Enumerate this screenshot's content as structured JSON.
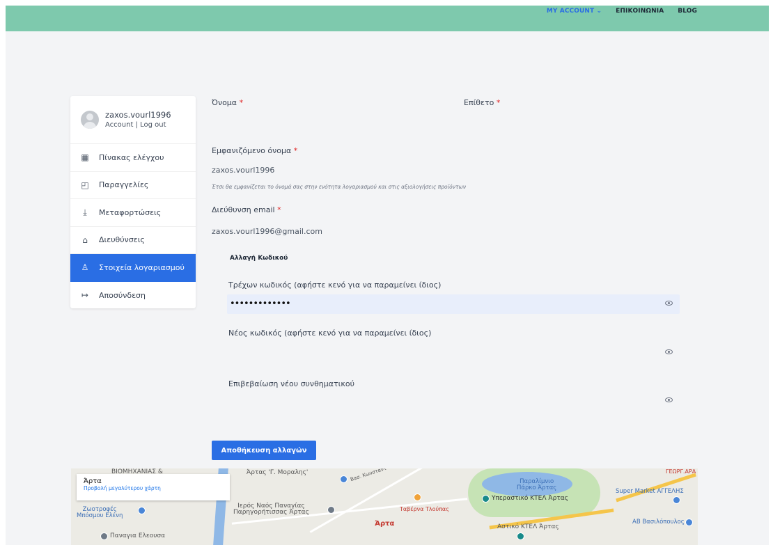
{
  "topnav": {
    "account": "MY ACCOUNT ⌄",
    "contact": "ΕΠΙΚΟΙΝΩΝΙΑ",
    "blog": "BLOG"
  },
  "sidebar": {
    "username": "zaxos.vourl1996",
    "account_link": "Account",
    "separator": " | ",
    "logout_link": "Log out",
    "items": [
      {
        "label": "Πίνακας ελέγχου",
        "icon": "dashboard-icon"
      },
      {
        "label": "Παραγγελίες",
        "icon": "orders-icon"
      },
      {
        "label": "Μεταφορτώσεις",
        "icon": "download-icon"
      },
      {
        "label": "Διευθύνσεις",
        "icon": "home-icon"
      },
      {
        "label": "Στοιχεία λογαριασμού",
        "icon": "user-icon",
        "active": true
      },
      {
        "label": "Αποσύνδεση",
        "icon": "logout-icon"
      }
    ]
  },
  "form": {
    "first_name_label": "Όνομα",
    "last_name_label": "Επίθετο",
    "display_name_label": "Εμφανιζόμενο όνομα",
    "display_name_value": "zaxos.vourl1996",
    "display_name_hint": "Έτσι θα εμφανίζεται το όνομά σας στην ενότητα λογαριασμού και στις αξιολογήσεις προϊόντων",
    "email_label": "Διεύθυνση email",
    "email_value": "zaxos.vourl1996@gmail.com",
    "required_mark": "*",
    "password_section_title": "Αλλαγή Κωδικού",
    "current_password_label": "Τρέχων κωδικός (αφήστε κενό για να παραμείνει ίδιος)",
    "current_password_value": "•••••••••••••",
    "new_password_label": "Νέος κωδικός (αφήστε κενό για να παραμείνει ίδιος)",
    "confirm_password_label": "Επιβεβαίωση νέου συνθηματικού",
    "save_button": "Αποθήκευση αλλαγών"
  },
  "map": {
    "place_title": "Άρτα",
    "larger_map_link": "Προβολή μεγαλύτερου χάρτη",
    "labels": {
      "pet_store": "Ζωοτροφές\nΜπόσμου Ελένη",
      "church1": "Παναγια Ελεουσα",
      "church2": "Ιερός Ναός Παναγίας\nΠαρηγορήτισσας Άρτας",
      "taverna": "Ταβέρνα Τλούπας",
      "town": "Άρτα",
      "park": "Παραλίμνιο\nΠάρκο Άρτας",
      "ktel": "Υπεραστικό ΚΤΕΛ Άρτας",
      "supermarket": "Super Market ΑΓΓΕΛΗΣ",
      "vasilopoulos": "ΑΒ Βασιλόπουλος",
      "ktel2": "Αστικό ΚΤΕΛ Άρτας",
      "street_moralis": "Άρτας 'Γ. Μοραλης'",
      "street_kwnst": "Βασ. Κωνσταντ",
      "top_right": "ΓΕΩΡΓ.ΑΡΑ",
      "top_left": "ΒΙΟΜΗΧΑΝΙΑΣ &"
    }
  }
}
